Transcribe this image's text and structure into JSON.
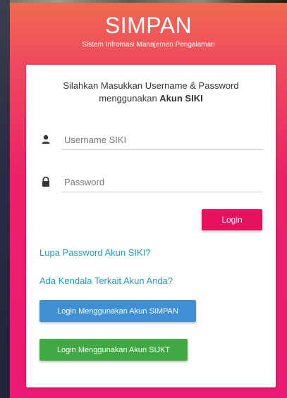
{
  "header": {
    "brand": "SIMPAN",
    "subtitle": "Sistem Infromasi Manajemen Pengalaman"
  },
  "intro": {
    "line1": "Silahkan Masukkan Username & Password",
    "line2_prefix": "menggunakan ",
    "line2_bold": "Akun SIKI"
  },
  "form": {
    "username": {
      "placeholder": "Username SIKI",
      "value": "",
      "icon": "user-icon"
    },
    "password": {
      "placeholder": "Password",
      "value": "",
      "icon": "lock-icon"
    },
    "login_label": "Login"
  },
  "links": {
    "forgot_password": "Lupa Password Akun SIKI?",
    "account_issue": "Ada Kendala Terkait Akun Anda?"
  },
  "alt_logins": {
    "simpan": "Login Menggunakan Akun SIMPAN",
    "sijkt": "Login Menggunakan Akun SIJKT"
  },
  "colors": {
    "gradient_top": "#f26a4f",
    "gradient_bottom": "#eb1a73",
    "login_button": "#e5115c",
    "simpan_button": "#3f8fd4",
    "sijkt_button": "#40a944",
    "link": "#1a9dbf"
  }
}
